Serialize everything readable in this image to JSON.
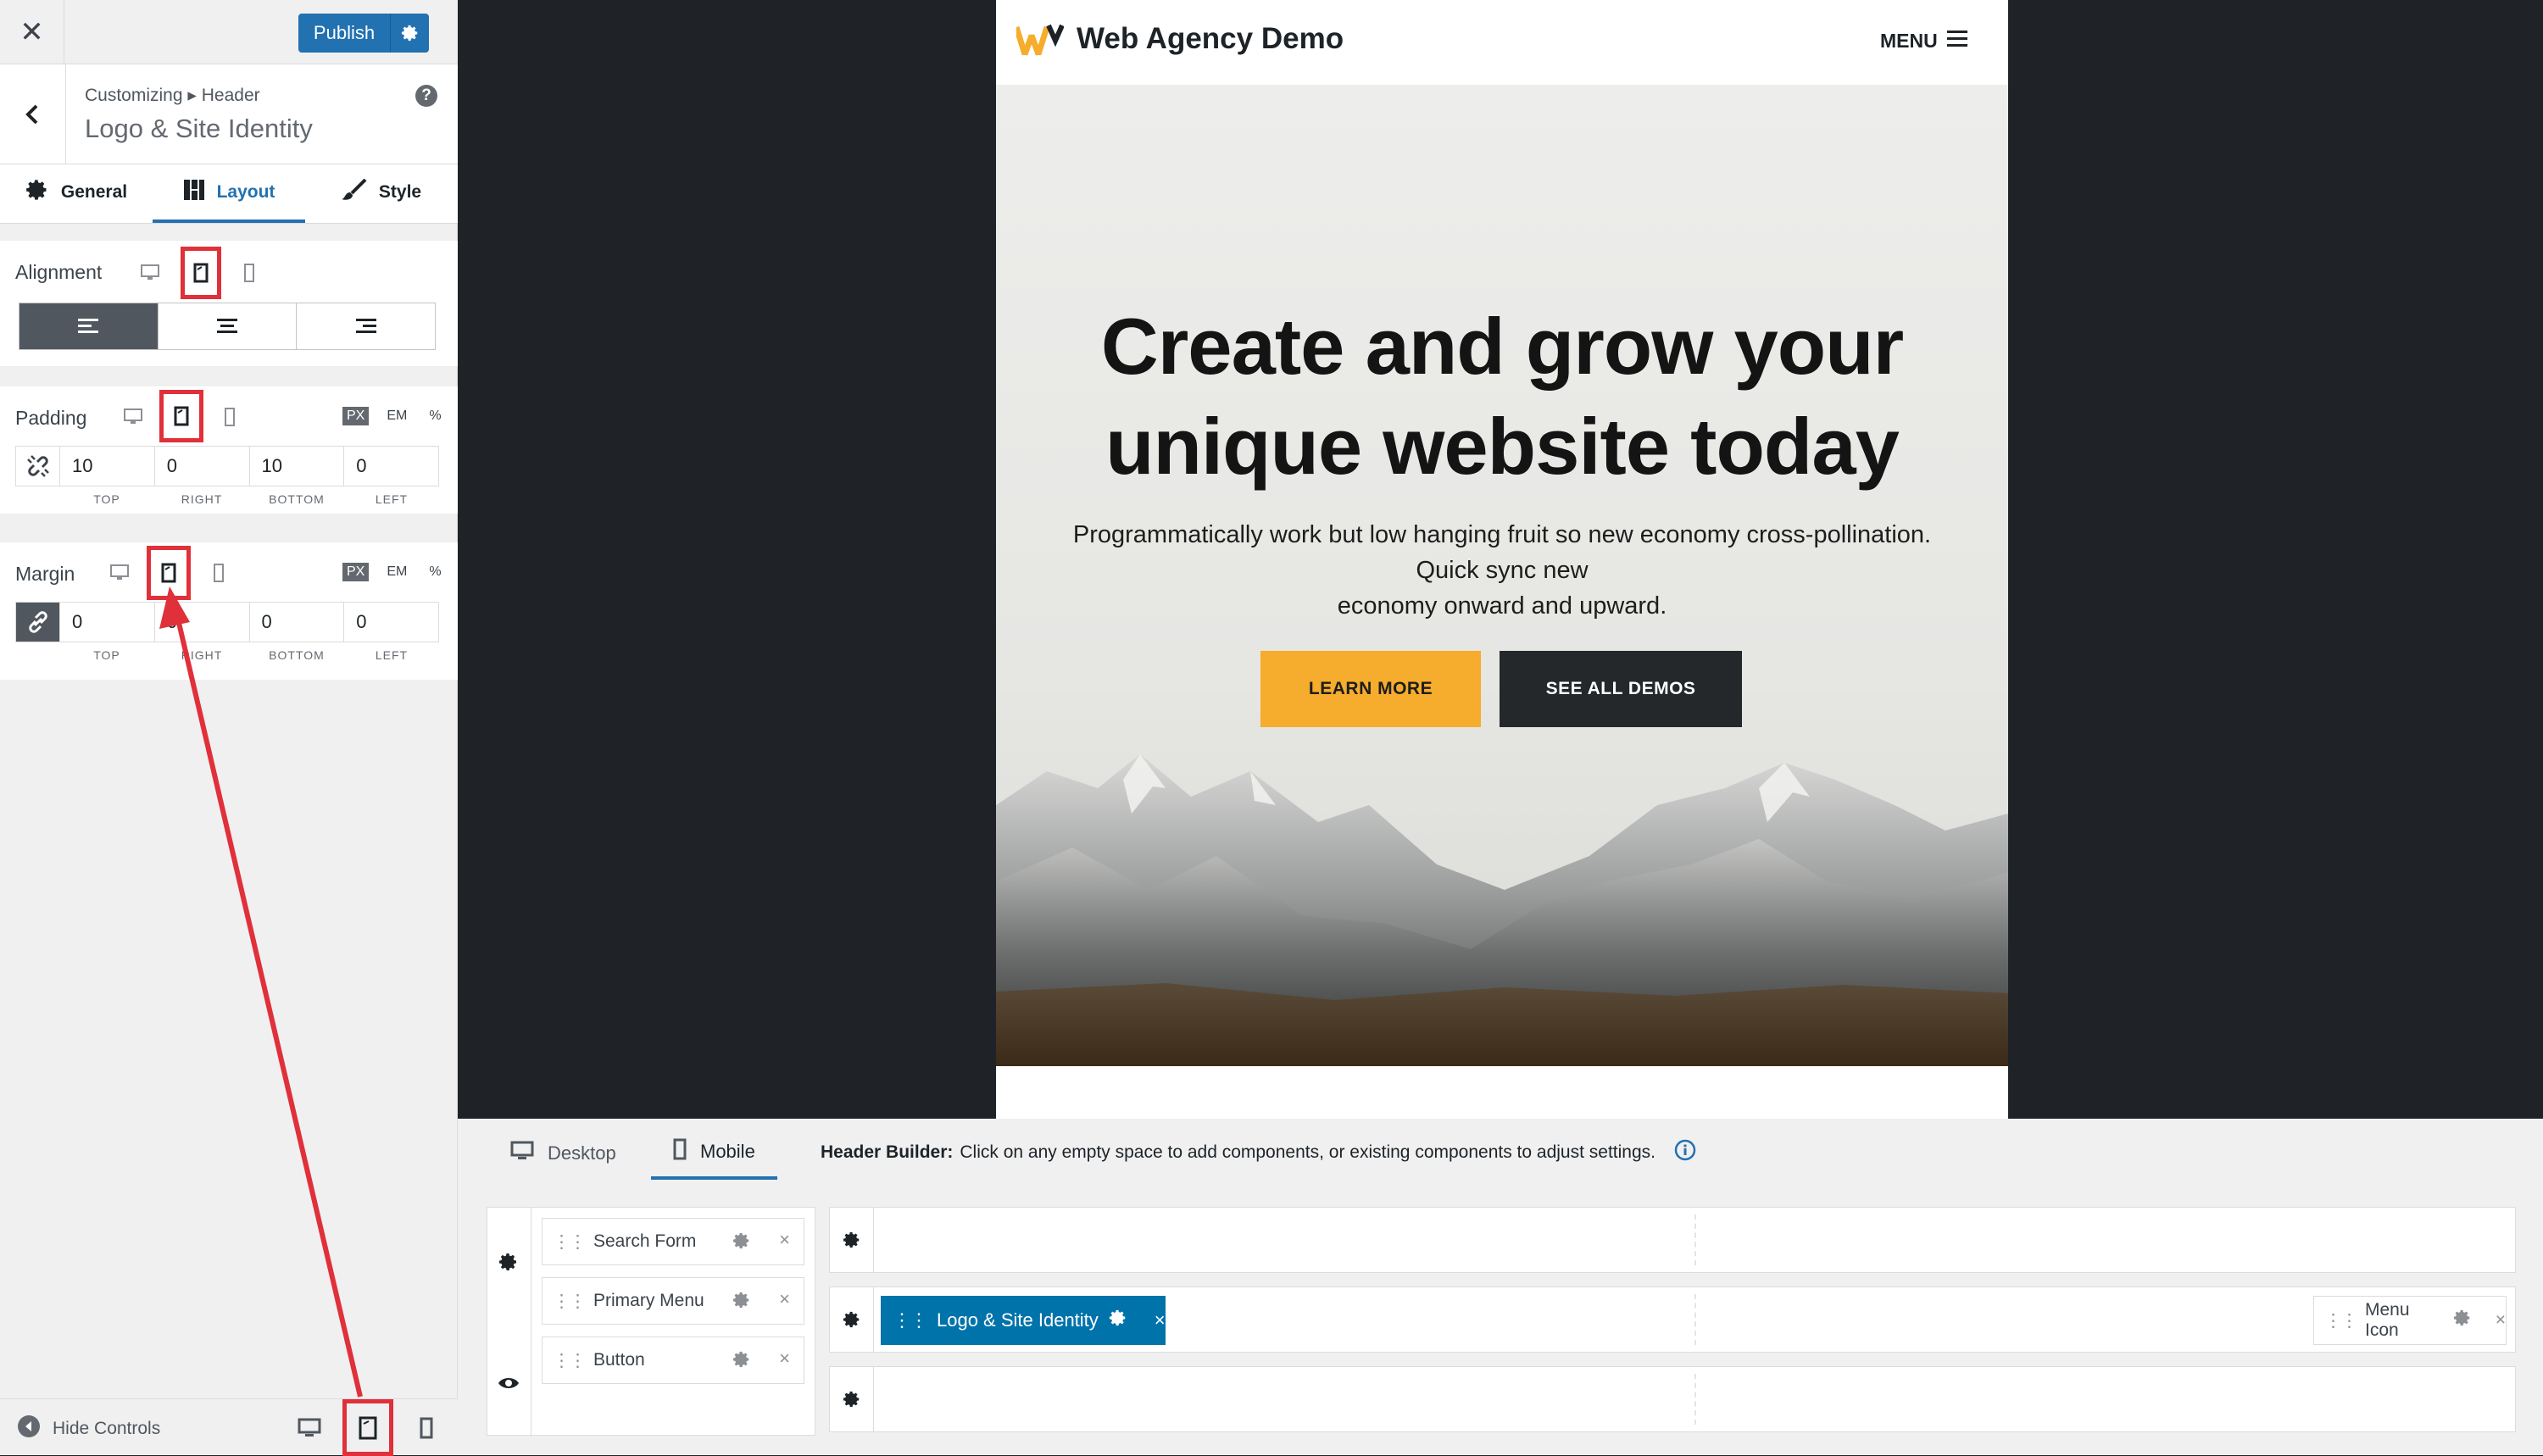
{
  "colors": {
    "accent": "#2271b1",
    "highlight": "#e0303a",
    "learn_more": "#f6ac2c",
    "dark_button": "#25282b"
  },
  "customizer": {
    "close_icon": "close-icon",
    "publish_label": "Publish",
    "breadcrumb": "Customizing ▸ Header",
    "section_title": "Logo & Site Identity",
    "tabs": [
      {
        "label": "General",
        "icon": "gear-icon"
      },
      {
        "label": "Layout",
        "icon": "layout-icon"
      },
      {
        "label": "Style",
        "icon": "brush-icon"
      }
    ],
    "alignment": {
      "label": "Alignment",
      "selected": "left"
    },
    "padding": {
      "label": "Padding",
      "units": [
        "PX",
        "EM",
        "%"
      ],
      "values": [
        "10",
        "0",
        "10",
        "0"
      ],
      "sides": [
        "TOP",
        "RIGHT",
        "BOTTOM",
        "LEFT"
      ]
    },
    "margin": {
      "label": "Margin",
      "units": [
        "PX",
        "EM",
        "%"
      ],
      "values": [
        "0",
        "0",
        "0",
        "0"
      ],
      "sides": [
        "TOP",
        "RIGHT",
        "BOTTOM",
        "LEFT"
      ]
    },
    "hide_controls": "Hide Controls"
  },
  "preview": {
    "site_title": "Web Agency Demo",
    "menu_label": "MENU",
    "hero_title_line1": "Create and grow your",
    "hero_title_line2": "unique website today",
    "hero_text_line1": "Programmatically work but low hanging fruit so new economy cross-pollination.",
    "hero_text_line2": "Quick sync new",
    "hero_text_line3": "economy onward and upward.",
    "learn_more": "LEARN MORE",
    "see_all_demos": "SEE ALL DEMOS"
  },
  "builder": {
    "tab_desktop": "Desktop",
    "tab_mobile": "Mobile",
    "info_label": "Header Builder:",
    "info_text": "Click on any empty space to add components, or existing components to adjust settings.",
    "available": [
      "Search Form",
      "Primary Menu",
      "Button"
    ],
    "logo_chip": "Logo & Site Identity",
    "menu_icon_chip": "Menu Icon"
  }
}
